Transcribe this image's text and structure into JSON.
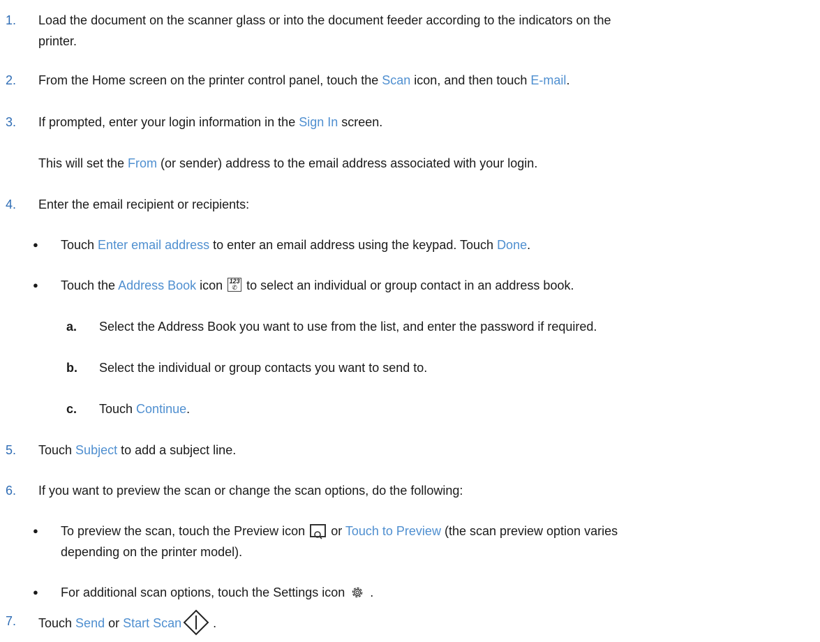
{
  "steps": {
    "s1": {
      "num": "1.",
      "text": "Load the document on the scanner glass or into the document feeder according to the indicators on the",
      "text_line2": "printer."
    },
    "s2": {
      "num": "2.",
      "t1": "From the Home screen on the printer control panel, touch the ",
      "scan": "Scan",
      "t2": " icon, and then touch ",
      "email": "E-mail",
      "t3": "."
    },
    "s3": {
      "num": "3.",
      "t1": "If prompted, enter your login information in the ",
      "signin": "Sign In",
      "t2": " screen.",
      "note_t1": "This will set the ",
      "from": "From",
      "note_t2": " (or sender) address to the email address associated with your login."
    },
    "s4": {
      "num": "4.",
      "text": "Enter the email recipient or recipients:",
      "b1": {
        "t1": "Touch ",
        "enter_email": "Enter email address",
        "t2": " to enter an email address using the keypad. Touch ",
        "done": "Done",
        "t3": "."
      },
      "b2": {
        "t1": "Touch the ",
        "address_book": "Address Book",
        "t2": " icon ",
        "t3": " to select an individual or group contact in an address book.",
        "icon_text": "123"
      },
      "a": {
        "letter": "a.",
        "text": "Select the Address Book you want to use from the list, and enter the password if required."
      },
      "b": {
        "letter": "b.",
        "text": "Select the individual or group contacts you want to send to."
      },
      "c": {
        "letter": "c.",
        "t1": "Touch ",
        "continue": "Continue",
        "t2": "."
      }
    },
    "s5": {
      "num": "5.",
      "t1": "Touch ",
      "subject": "Subject",
      "t2": " to add a subject line."
    },
    "s6": {
      "num": "6.",
      "text": "If you want to preview the scan or change the scan options, do the following:",
      "b1": {
        "t1": "To preview the scan, touch the Preview icon ",
        "t2": " or ",
        "touch_preview": "Touch to Preview",
        "t3": " (the scan preview option varies",
        "line2": "depending on the printer model)."
      },
      "b2": {
        "t1": "For additional scan options, touch the Settings icon ",
        "t2": " ."
      }
    },
    "s7": {
      "num": "7.",
      "t1": "Touch ",
      "send": "Send",
      "t2": " or ",
      "start_scan": "Start Scan",
      "t3": " ."
    }
  },
  "bullet_glyph": "●",
  "colors": {
    "step_number": "#2f6db5",
    "ui_term": "#4f8fd0",
    "text": "#1a1a1a"
  }
}
